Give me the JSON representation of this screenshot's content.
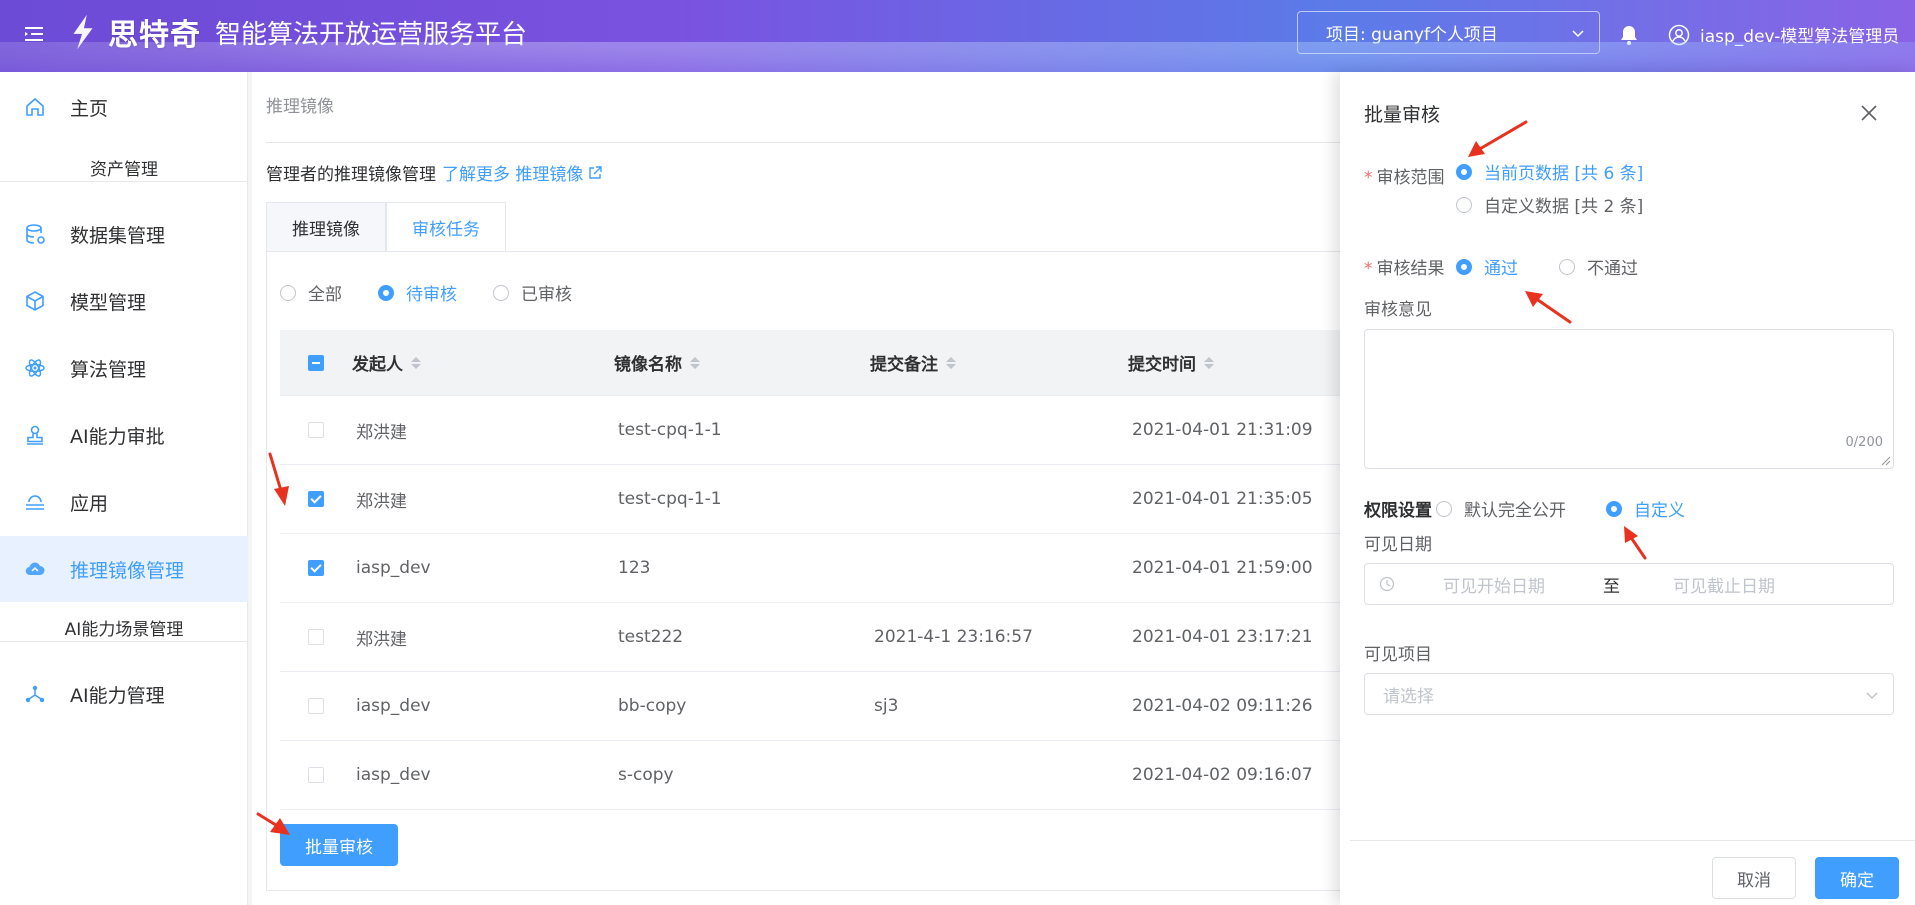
{
  "header": {
    "brand": "思特奇",
    "title": "智能算法开放运营服务平台",
    "project_select": "项目: guanyf个人项目",
    "user": "iasp_dev-模型算法管理员"
  },
  "sidebar": {
    "home": "主页",
    "group_assets": "资产管理",
    "items": [
      "数据集管理",
      "模型管理",
      "算法管理",
      "AI能力审批",
      "应用",
      "推理镜像管理"
    ],
    "group_scene": "AI能力场景管理",
    "ai_manage": "AI能力管理"
  },
  "main": {
    "breadcrumb": "推理镜像",
    "desc": "管理者的推理镜像管理",
    "desc_link": "了解更多 推理镜像",
    "tabs": [
      "推理镜像",
      "审核任务"
    ],
    "filters": [
      "全部",
      "待审核",
      "已审核"
    ],
    "columns": [
      "发起人",
      "镜像名称",
      "提交备注",
      "提交时间"
    ],
    "rows": [
      {
        "initiator": "郑洪建",
        "image": "test-cpq-1-1",
        "note": "",
        "time": "2021-04-01 21:31:09",
        "checked": false
      },
      {
        "initiator": "郑洪建",
        "image": "test-cpq-1-1",
        "note": "",
        "time": "2021-04-01 21:35:05",
        "checked": true
      },
      {
        "initiator": "iasp_dev",
        "image": "123",
        "note": "",
        "time": "2021-04-01 21:59:00",
        "checked": true
      },
      {
        "initiator": "郑洪建",
        "image": "test222",
        "note": "2021-4-1 23:16:57",
        "time": "2021-04-01 23:17:21",
        "checked": false
      },
      {
        "initiator": "iasp_dev",
        "image": "bb-copy",
        "note": "sj3",
        "time": "2021-04-02 09:11:26",
        "checked": false
      },
      {
        "initiator": "iasp_dev",
        "image": "s-copy",
        "note": "",
        "time": "2021-04-02 09:16:07",
        "checked": false
      }
    ],
    "batch_button": "批量审核"
  },
  "drawer": {
    "title": "批量审核",
    "scope_label": "审核范围",
    "scope_current": "当前页数据 [共 6 条]",
    "scope_custom": "自定义数据 [共 2 条]",
    "result_label": "审核结果",
    "result_pass": "通过",
    "result_fail": "不通过",
    "opinion_label": "审核意见",
    "opinion_count": "0/200",
    "perm_label": "权限设置",
    "perm_public": "默认完全公开",
    "perm_custom": "自定义",
    "visible_date_label": "可见日期",
    "date_start": "可见开始日期",
    "date_sep": "至",
    "date_end": "可见截止日期",
    "visible_project_label": "可见项目",
    "select_placeholder": "请选择",
    "cancel": "取消",
    "ok": "确定"
  },
  "colors": {
    "primary": "#409eff",
    "required": "#f56c6c",
    "arrow": "#e8321f"
  }
}
